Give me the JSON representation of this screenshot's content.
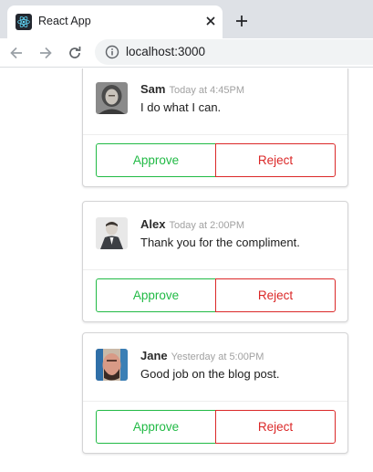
{
  "browser": {
    "tab_title": "React App",
    "tab_icon": "react-icon",
    "url": "localhost:3000"
  },
  "colors": {
    "approve": "#21ba45",
    "reject": "#db2828"
  },
  "comments": [
    {
      "author": "Sam",
      "timestamp": "Today at 4:45PM",
      "text": "I do what I can.",
      "approve_label": "Approve",
      "reject_label": "Reject"
    },
    {
      "author": "Alex",
      "timestamp": "Today at 2:00PM",
      "text": "Thank you for the compliment.",
      "approve_label": "Approve",
      "reject_label": "Reject"
    },
    {
      "author": "Jane",
      "timestamp": "Yesterday at 5:00PM",
      "text": "Good job on the blog post.",
      "approve_label": "Approve",
      "reject_label": "Reject"
    }
  ]
}
